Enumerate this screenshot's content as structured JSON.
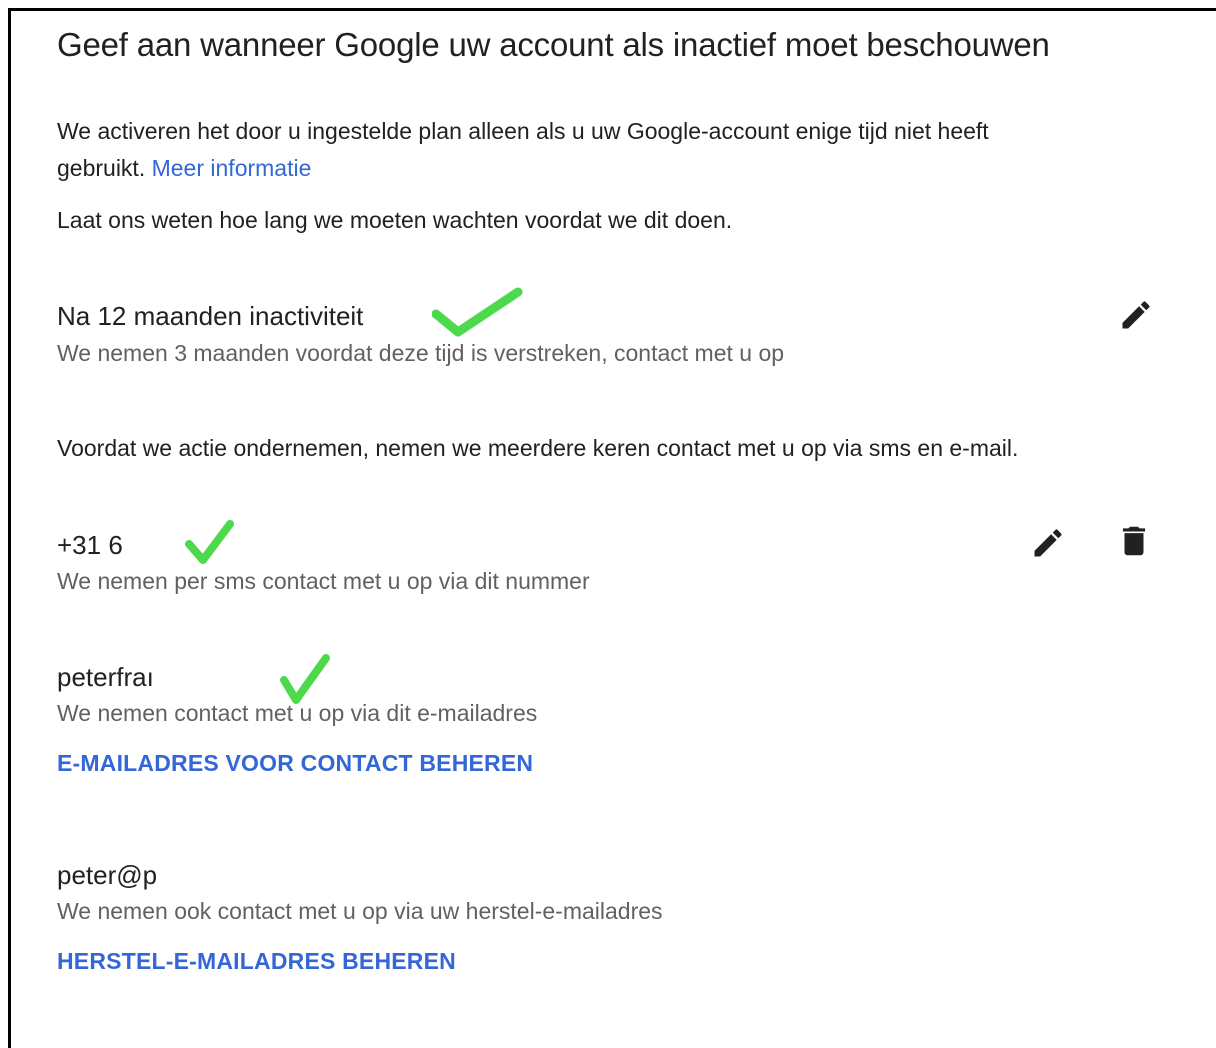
{
  "page": {
    "title": "Geef aan wanneer Google uw account als inactief moet beschouwen",
    "intro_text": "We activeren het door u ingestelde plan alleen als u uw Google-account enige tijd niet heeft",
    "intro_text_2": "gebruikt.",
    "more_info_link": "Meer informatie",
    "wait_text": "Laat ons weten hoe lang we moeten wachten voordat we dit doen."
  },
  "timeout": {
    "label": "Na 12 maanden inactiviteit",
    "description": "We nemen 3 maanden voordat deze tijd is verstreken, contact met u op",
    "edit_icon": "pencil-icon"
  },
  "contact_intro": "Voordat we actie ondernemen, nemen we meerdere keren contact met u op via sms en e-mail.",
  "phone": {
    "number": "+31 6",
    "description": "We nemen per sms contact met u op via dit nummer",
    "edit_icon": "pencil-icon",
    "delete_icon": "trash-icon"
  },
  "contact_email": {
    "address": "peterfraı",
    "description": "We nemen contact met u op via dit e-mailadres",
    "manage_label": "E-MAILADRES VOOR CONTACT BEHEREN"
  },
  "recovery_email": {
    "address": "peter@p",
    "description": "We nemen ook contact met u op via uw herstel-e-mailadres",
    "manage_label": "HERSTEL-E-MAILADRES BEHEREN"
  },
  "colors": {
    "link": "#3367d6",
    "checkmark": "#4cd94c",
    "icon": "#212121"
  }
}
